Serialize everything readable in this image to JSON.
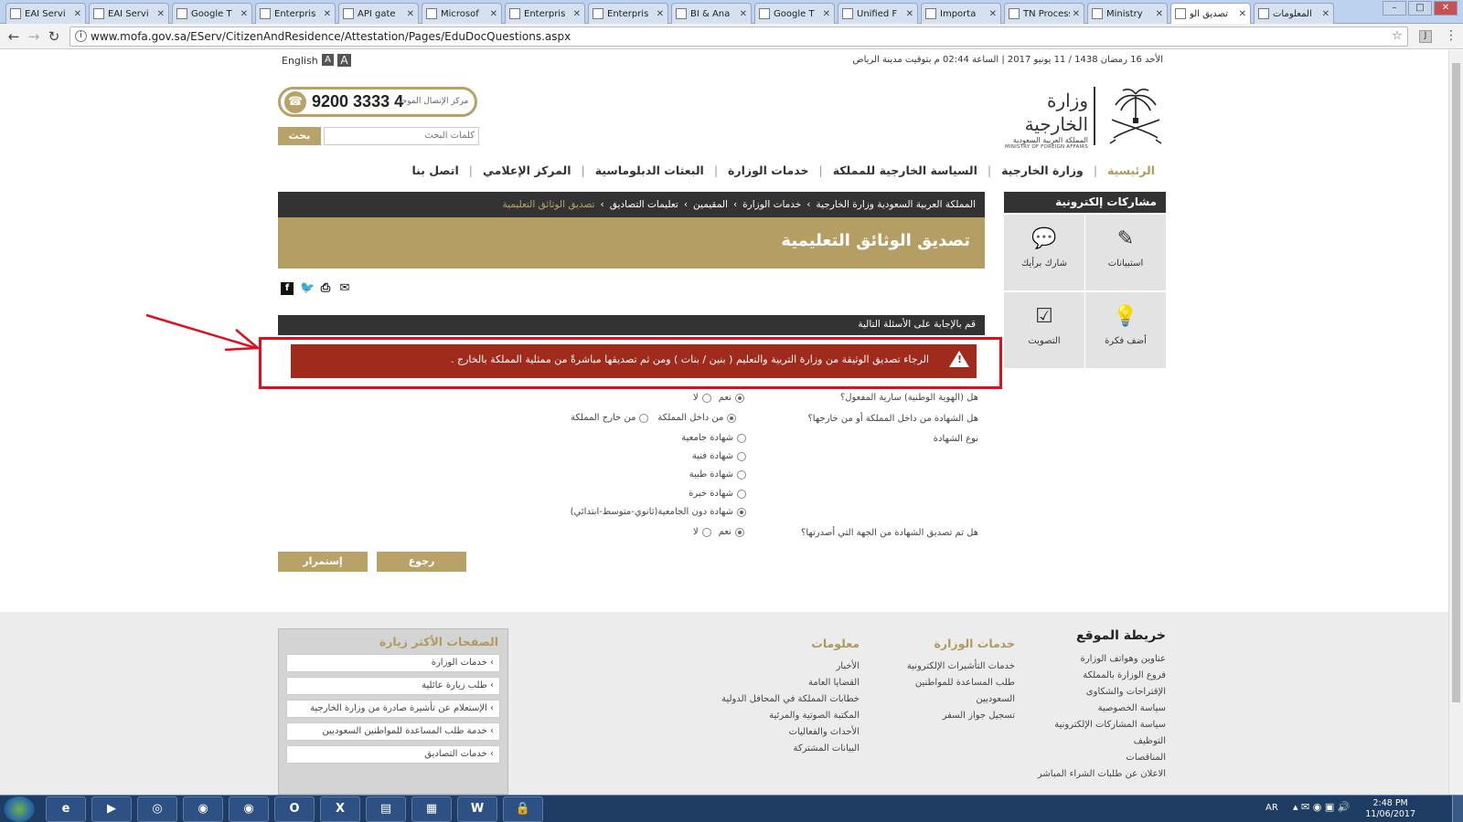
{
  "browser": {
    "tabs": [
      {
        "label": "EAI Servi",
        "active": false
      },
      {
        "label": "EAI Servi",
        "active": false
      },
      {
        "label": "Google T",
        "active": false
      },
      {
        "label": "Enterpris",
        "active": false
      },
      {
        "label": "API gate",
        "active": false
      },
      {
        "label": "Microsof",
        "active": false
      },
      {
        "label": "Enterpris",
        "active": false
      },
      {
        "label": "Enterpris",
        "active": false
      },
      {
        "label": "BI & Ana",
        "active": false
      },
      {
        "label": "Google T",
        "active": false
      },
      {
        "label": "Unified F",
        "active": false
      },
      {
        "label": "Importa",
        "active": false
      },
      {
        "label": "TN Process",
        "active": false
      },
      {
        "label": "Ministry",
        "active": false
      },
      {
        "label": "تصديق الو",
        "active": true
      },
      {
        "label": "المعلومات",
        "active": false
      }
    ],
    "url": "www.mofa.gov.sa/EServ/CitizenAndResidence/Attestation/Pages/EduDocQuestions.aspx"
  },
  "topbar": {
    "datetime": "الأحد 16 رمضان 1438 / 11 يونيو 2017 | الساعة 02:44 م بتوقيت مدينة الرياض",
    "language_link": "English",
    "font_small": "A",
    "font_large": "A"
  },
  "header": {
    "call_center_label": "مركز الإتصال الموحد",
    "phone_number": "9200 3333 4",
    "search_placeholder": "كلمات البحث",
    "search_button": "بحث",
    "logo_arabic": "وزارة الخارجية",
    "logo_subtitle": "المملكة العربية السعودية",
    "logo_english": "MINISTRY OF FOREIGN AFFAIRS"
  },
  "nav": [
    {
      "label": "الرئيسية",
      "active": true
    },
    {
      "label": "وزارة الخارجية",
      "active": false
    },
    {
      "label": "السياسة الخارجية للمملكة",
      "active": false
    },
    {
      "label": "خدمات الوزارة",
      "active": false
    },
    {
      "label": "البعثات الدبلوماسية",
      "active": false
    },
    {
      "label": "المركز الإعلامي",
      "active": false
    },
    {
      "label": "اتصل بنا",
      "active": false
    }
  ],
  "breadcrumb": [
    "المملكة العربية السعودية وزارة الخارجية",
    "خدمات الوزارة",
    "المقيمين",
    "تعليمات التصاديق",
    "تصديق الوثائق التعليمية"
  ],
  "breadcrumb_separator": "›",
  "page_title": "تصديق الوثائق التعليمية",
  "social": {
    "facebook": "f",
    "twitter": "t",
    "print": "P",
    "email": "✉"
  },
  "eparticipation": {
    "title": "مشاركات إلكترونية",
    "items": [
      {
        "label": "استبيانات",
        "icon": "pencil-icon"
      },
      {
        "label": "شارك برأيك",
        "icon": "speech-bubble-icon"
      },
      {
        "label": "أضف فكرة",
        "icon": "lightbulb-icon"
      },
      {
        "label": "التصويت",
        "icon": "checkbox-icon"
      }
    ]
  },
  "questions_header": "قم بالإجابة على الأسئلة التالية",
  "alert_message": "الرجاء تصديق الوثيقة من وزارة التربية والتعليم ( بنين / بنات ) ومن ثم تصديقها مباشرةً من ممثلية المملكة بالخارج .",
  "form": {
    "q1": {
      "label": "هل (الهوية الوطنية) سارية المفعول؟",
      "options": [
        "نعم",
        "لا"
      ],
      "selected": "نعم"
    },
    "q2": {
      "label": "هل الشهادة من داخل المملكة أو من خارجها؟",
      "options": [
        "من داخل المملكة",
        "من خارج المملكة"
      ],
      "selected": "من داخل المملكة"
    },
    "q3": {
      "label": "نوع الشهادة",
      "options": [
        "شهادة جامعية",
        "شهادة فنية",
        "شهادة طبية",
        "شهادة خبرة",
        "شهادة دون الجامعية(ثانوي-متوسط-ابتدائي)"
      ],
      "selected": "شهادة دون الجامعية(ثانوي-متوسط-ابتدائي)"
    },
    "q4": {
      "label": "هل تم تصديق الشهادة من الجهة التي أصدرتها؟",
      "options": [
        "نعم",
        "لا"
      ],
      "selected": "نعم"
    },
    "continue_button": "إستمرار",
    "back_button": "رجوع"
  },
  "footer": {
    "most_visited_title": "الصفحات الأكثر زيارة",
    "most_visited": [
      "› خدمات الوزارة",
      "› طلب زيارة عائلية",
      "› الإستعلام عن تأشيرة صادرة من وزارة الخارجية",
      "› خدمة طلب المساعدة للمواطنين السعوديين",
      "› خدمات التصاديق"
    ],
    "info_title": "معلومات",
    "info_links": [
      "الأخبار",
      "القضايا العامة",
      "خطابات المملكة في المحافل الدولية",
      "المكتبة الصوتية والمرئية",
      "الأحداث والفعاليات",
      "البيانات المشتركة"
    ],
    "services_title": "خدمات الوزارة",
    "services_links": [
      "خدمات التأشيرات الإلكترونية",
      "طلب المساعدة للمواطنين السعوديين",
      "تسجيل جواز السفر"
    ],
    "sitemap_title": "خريطة الموقع",
    "sitemap_links": [
      "عناوين وهواتف الوزارة",
      "فروع الوزارة بالمملكة",
      "الإقتراحات والشكاوى",
      "سياسة الخصوصية",
      "سياسة المشاركات الإلكترونية",
      "التوظيف",
      "المناقصات",
      "الاعلان عن طلبات الشراء المباشر"
    ]
  },
  "taskbar": {
    "apps": [
      "ie-icon",
      "media-player-icon",
      "chrome-icon",
      "app-icon",
      "app-icon",
      "outlook-icon",
      "excel-icon",
      "folder-icon",
      "calculator-icon",
      "word-icon",
      "lock-icon"
    ],
    "language": "AR",
    "time": "2:48 PM",
    "date": "11/06/2017"
  },
  "colors": {
    "gold": "#b8a268",
    "dark": "#333333",
    "alert": "#a02a1c",
    "highlight_box": "#e20d1e"
  }
}
